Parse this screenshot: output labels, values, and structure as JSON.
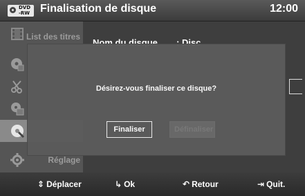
{
  "header": {
    "badge_top": "DVD",
    "badge_bottom": "-RW",
    "title": "Finalisation de disque",
    "clock": "12:00"
  },
  "sidebar": {
    "items": [
      {
        "label": "List des titres",
        "icon": "film-icon"
      },
      {
        "label": "",
        "icon": "edit-disc-icon"
      },
      {
        "label": "",
        "icon": "scissors-icon"
      },
      {
        "label": "",
        "icon": "copy-icon"
      },
      {
        "label": "",
        "icon": "disc-manager-icon",
        "active": true
      },
      {
        "label": "Réglage",
        "icon": "gear-icon"
      }
    ]
  },
  "content": {
    "disc_name_label": "Nom du disque",
    "disc_name_value": ": Disc"
  },
  "dialog": {
    "message": "Désirez-vous finaliser ce disque?",
    "confirm_label": "Finaliser",
    "other_label": "Définaliser"
  },
  "footer": {
    "move_icon": "⇕",
    "move": "Déplacer",
    "ok_icon": "↳",
    "ok": "Ok",
    "back_icon": "↶",
    "back": "Retour",
    "quit_icon": "⇥",
    "quit": "Quit."
  }
}
